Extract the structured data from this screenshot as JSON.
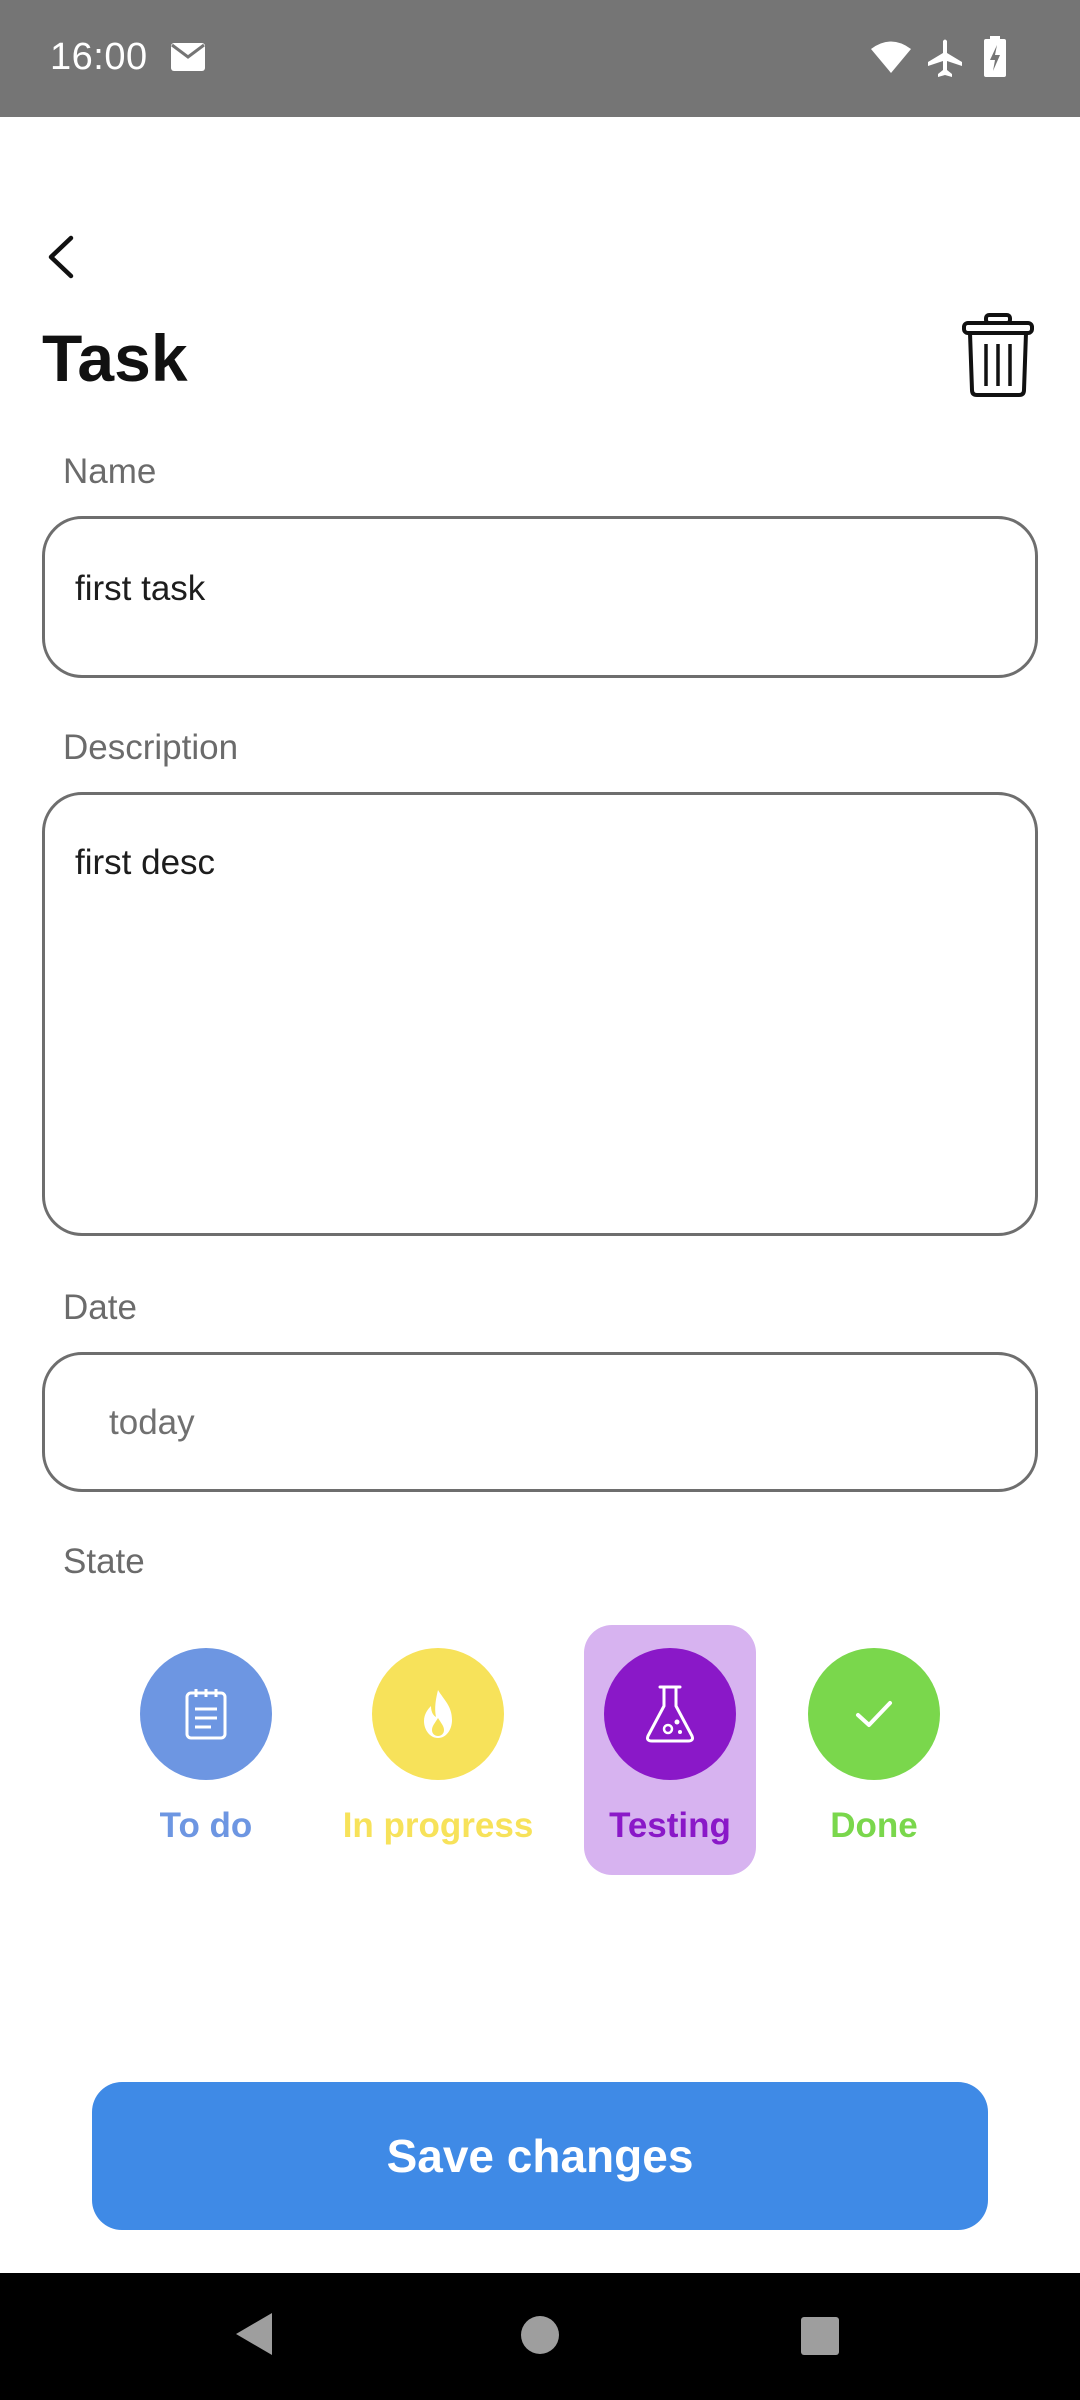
{
  "status_bar": {
    "time": "16:00",
    "icons": [
      "mail-icon",
      "wifi-icon",
      "airplane-icon",
      "battery-charging-icon"
    ]
  },
  "header": {
    "title": "Task",
    "back_icon": "chevron-left-icon",
    "delete_icon": "trash-icon"
  },
  "form": {
    "name_label": "Name",
    "name_value": "first task",
    "description_label": "Description",
    "description_value": "first desc",
    "date_label": "Date",
    "date_value": "today",
    "state_label": "State"
  },
  "states": [
    {
      "label": "To do",
      "icon": "notepad-icon",
      "color": "#6d96e2",
      "selected": false
    },
    {
      "label": "In progress",
      "icon": "flame-icon",
      "color": "#f7e25a",
      "selected": false
    },
    {
      "label": "Testing",
      "icon": "flask-icon",
      "color": "#8a18c8",
      "selected": true
    },
    {
      "label": "Done",
      "icon": "checkmark-icon",
      "color": "#7ad74c",
      "selected": false
    }
  ],
  "save_label": "Save changes",
  "colors": {
    "primary": "#3f8ae6",
    "status_bar": "#757575",
    "selected_state_bg": "#d7b3f0"
  }
}
